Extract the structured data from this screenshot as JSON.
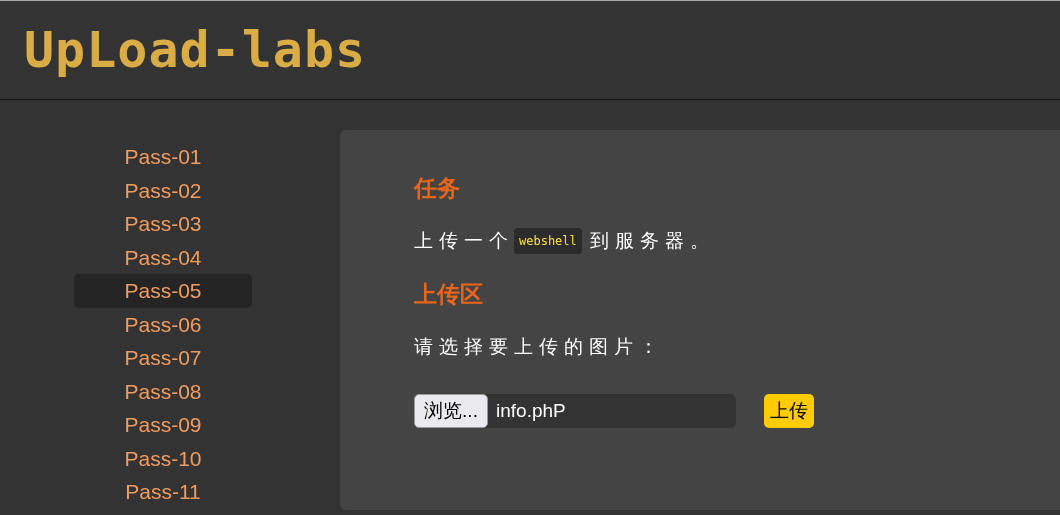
{
  "header": {
    "logo": "UpLoad-labs"
  },
  "sidebar": {
    "items": [
      {
        "label": "Pass-01",
        "selected": false
      },
      {
        "label": "Pass-02",
        "selected": false
      },
      {
        "label": "Pass-03",
        "selected": false
      },
      {
        "label": "Pass-04",
        "selected": false
      },
      {
        "label": "Pass-05",
        "selected": true
      },
      {
        "label": "Pass-06",
        "selected": false
      },
      {
        "label": "Pass-07",
        "selected": false
      },
      {
        "label": "Pass-08",
        "selected": false
      },
      {
        "label": "Pass-09",
        "selected": false
      },
      {
        "label": "Pass-10",
        "selected": false
      },
      {
        "label": "Pass-11",
        "selected": false
      }
    ]
  },
  "task": {
    "heading": "任务",
    "text_before": "上传一个",
    "code": "webshell",
    "text_after": "到服务器。"
  },
  "upload": {
    "heading": "上传区",
    "prompt": "请选择要上传的图片：",
    "browse_button": "浏览...",
    "file_name": "info.phP",
    "submit_button": "上传"
  }
}
